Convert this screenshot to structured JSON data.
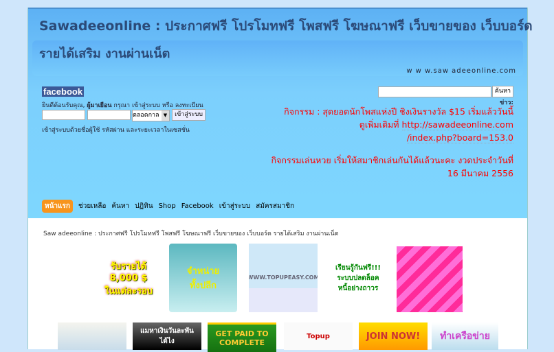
{
  "header": {
    "title_line1": "Sawadeeonline : ประกาศฟรี โปรโมทฟรี โพสฟรี โฆษณาฟรี เว็บขายของ เว็บบอร์ด",
    "title_line2": "รายได้เสริม งานผ่านเน็ต",
    "url": "w w w.saw adeeonline.com"
  },
  "login": {
    "logo": "facebook",
    "welcome": "ยินดีต้อนรับคุณ,",
    "guest": "ผู้มาเยือน",
    "please": "กรุณา",
    "login_link": "เข้าสู่ระบบ",
    "or": "หรือ",
    "register_link": "ลงทะเบียน",
    "username_value": "",
    "password_value": "",
    "duration_selected": "ตลอดกาล",
    "submit": "เข้าสู่ระบบ",
    "hint": "เข้าสู่ระบบด้วยชื่อผู้ใช้ รหัสผ่าน และระยะเวลาในเซสชั่น"
  },
  "search": {
    "value": "",
    "button": "ค้นหา"
  },
  "news": {
    "label": "ข่าว:",
    "item1_text": "กิจกรรม : สุดยอดนักโพสแห่งปี ชิงเงินรางวัล $15 เริ่มแล้ววันนี้",
    "item1_more": "ดูเพิ่มเติมที่",
    "item1_link_a": "http://sawadeeonline.com",
    "item1_link_b": "/index.php?board=153.0",
    "item2_a": "กิจกรรมเล่นหวย เริ่มให้สมาชิกเล่นกันได้แล้วนะคะ งวดประจำวันที่",
    "item2_b": "16 มีนาคม 2556"
  },
  "nav": [
    "หน้าแรก",
    "ช่วยเหลือ",
    "ค้นหา",
    "ปฏิทิน",
    "Shop",
    "Facebook",
    "เข้าสู่ระบบ",
    "สมัครสมาชิก"
  ],
  "breadcrumb": "Saw adeeonline : ประกาศฟรี โปรโมทฟรี  โพสฟรี  โฆษณาฟรี เว็บขายของ  เว็บบอร์ด รายได้เสริม งานผ่านเน็ต",
  "ads_row1": [
    "รับรายได้\n8,000 $\nในแต่ละรอบ",
    "จำหน่าย\nทั้งปลีก",
    "WWW.TOPUPEASY.COM",
    "เรียนรู้กันฟรี!!!\nระบบปลดล็อค\nหนี้อย่างถาวร",
    ""
  ],
  "ads_row2": [
    "",
    "แมหาเงินวันละพัน\nได้ไง",
    "GET PAID TO\nCOMPLETE",
    "Topup",
    "JOIN NOW!",
    "ทำเครือข่าย"
  ]
}
